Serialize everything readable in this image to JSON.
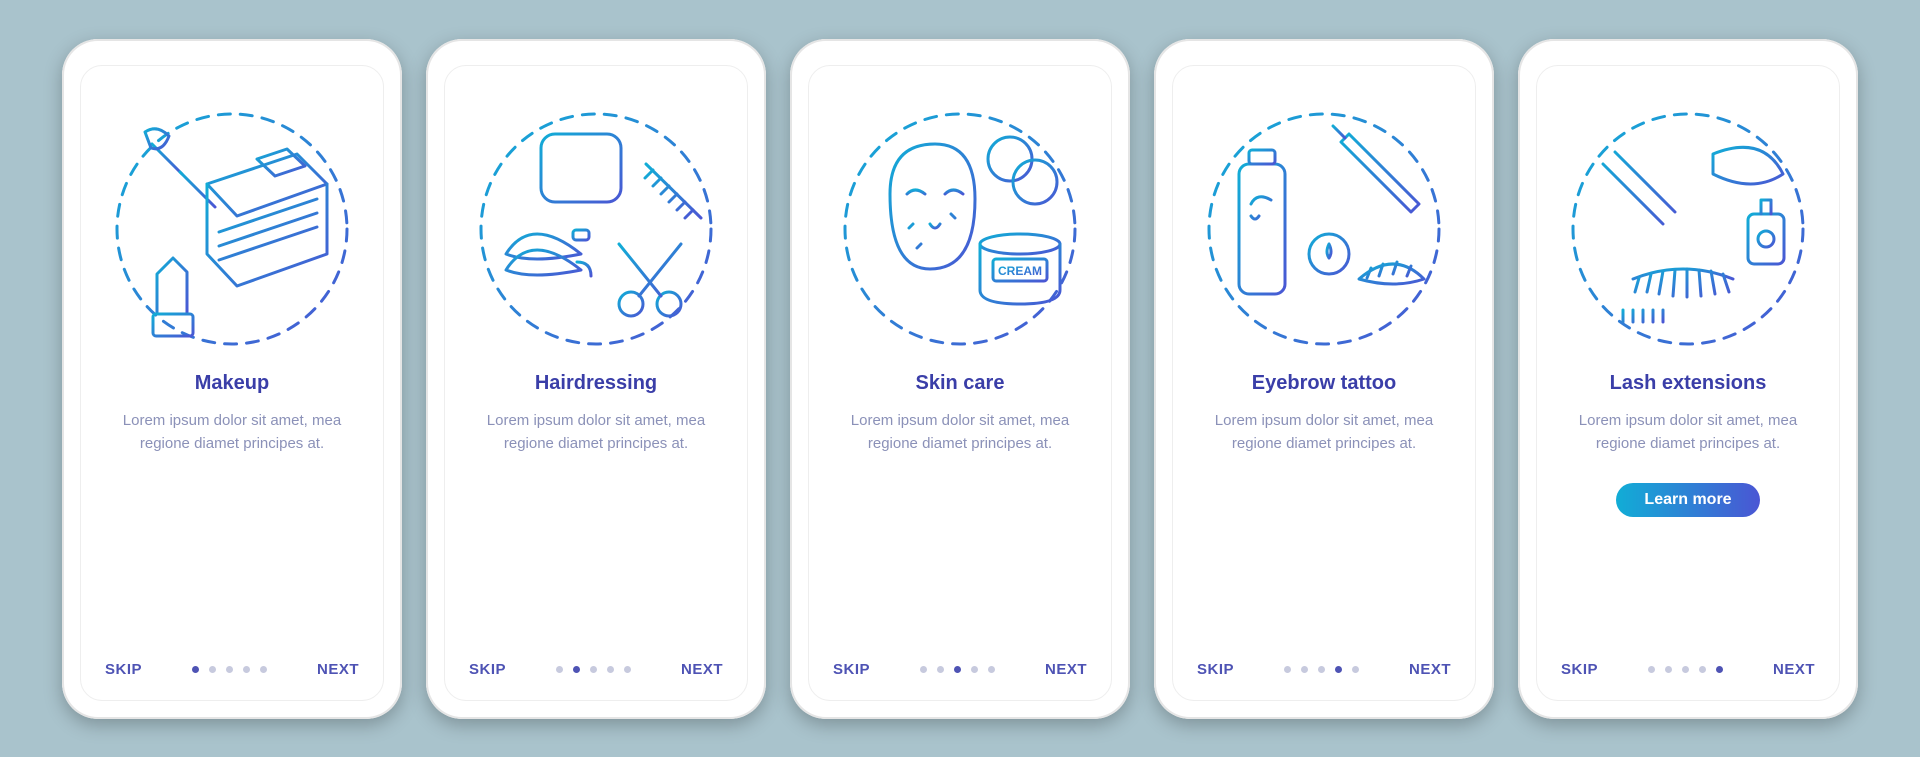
{
  "common": {
    "skip_label": "SKIP",
    "next_label": "NEXT",
    "description": "Lorem ipsum dolor sit amet, mea regione diamet principes at.",
    "cta_label": "Learn more"
  },
  "screens": [
    {
      "title": "Makeup",
      "illustration": "makeup-icon",
      "active_dot": 0,
      "has_cta": false
    },
    {
      "title": "Hairdressing",
      "illustration": "hairdressing-icon",
      "active_dot": 1,
      "has_cta": false
    },
    {
      "title": "Skin care",
      "illustration": "skincare-icon",
      "active_dot": 2,
      "has_cta": false
    },
    {
      "title": "Eyebrow tattoo",
      "illustration": "eyebrow-tattoo-icon",
      "active_dot": 3,
      "has_cta": false
    },
    {
      "title": "Lash extensions",
      "illustration": "lash-extensions-icon",
      "active_dot": 4,
      "has_cta": true
    }
  ],
  "colors": {
    "gradient_start": "#11add6",
    "gradient_end": "#4a56d4",
    "title": "#3a3ea8",
    "text_muted": "#8b91b8",
    "background": "#a9c3cc"
  }
}
